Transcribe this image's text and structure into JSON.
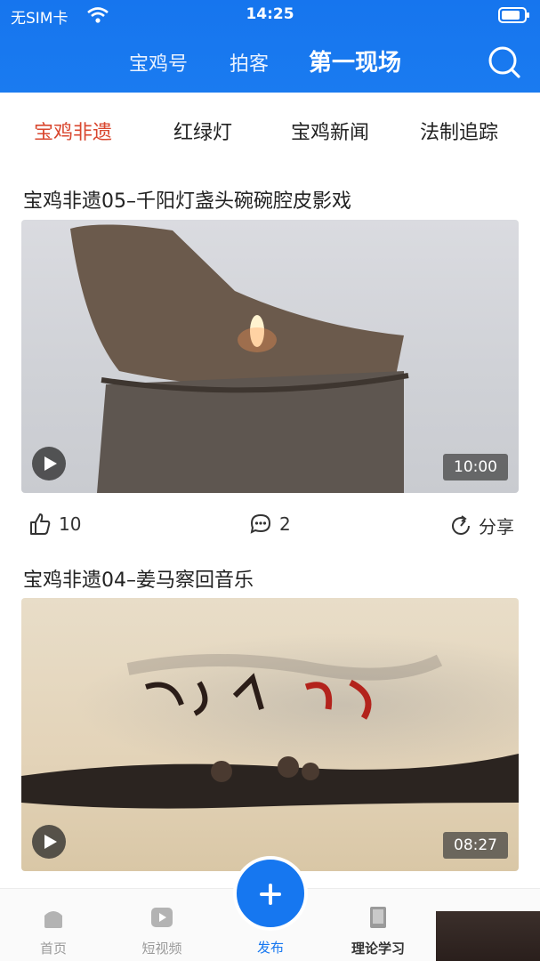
{
  "status_bar": {
    "carrier": "无SIM卡",
    "time": "14:25"
  },
  "top_nav": {
    "tabs": [
      "宝鸡号",
      "拍客",
      "第一现场"
    ],
    "active": "第一现场"
  },
  "categories": {
    "items": [
      "宝鸡非遗",
      "红绿灯",
      "宝鸡新闻",
      "法制追踪"
    ],
    "active": "宝鸡非遗"
  },
  "feed": {
    "items": [
      {
        "title": "宝鸡非遗05–千阳灯盏头碗碗腔皮影戏",
        "duration": "10:00",
        "likes": "10",
        "comments": "2",
        "share": "分享"
      },
      {
        "title": "宝鸡非遗04–姜马察回音乐",
        "duration": "08:27"
      }
    ]
  },
  "tabbar": {
    "items": [
      {
        "label": "首页",
        "icon": "home-icon"
      },
      {
        "label": "短视频",
        "icon": "short-video-icon"
      },
      {
        "label": "发布",
        "icon": "plus-icon"
      },
      {
        "label": "理论学习",
        "icon": "book-icon"
      }
    ]
  },
  "colors": {
    "header_blue": "#1675ee",
    "accent_red": "#d9472f",
    "fab_blue": "#1677f0"
  }
}
